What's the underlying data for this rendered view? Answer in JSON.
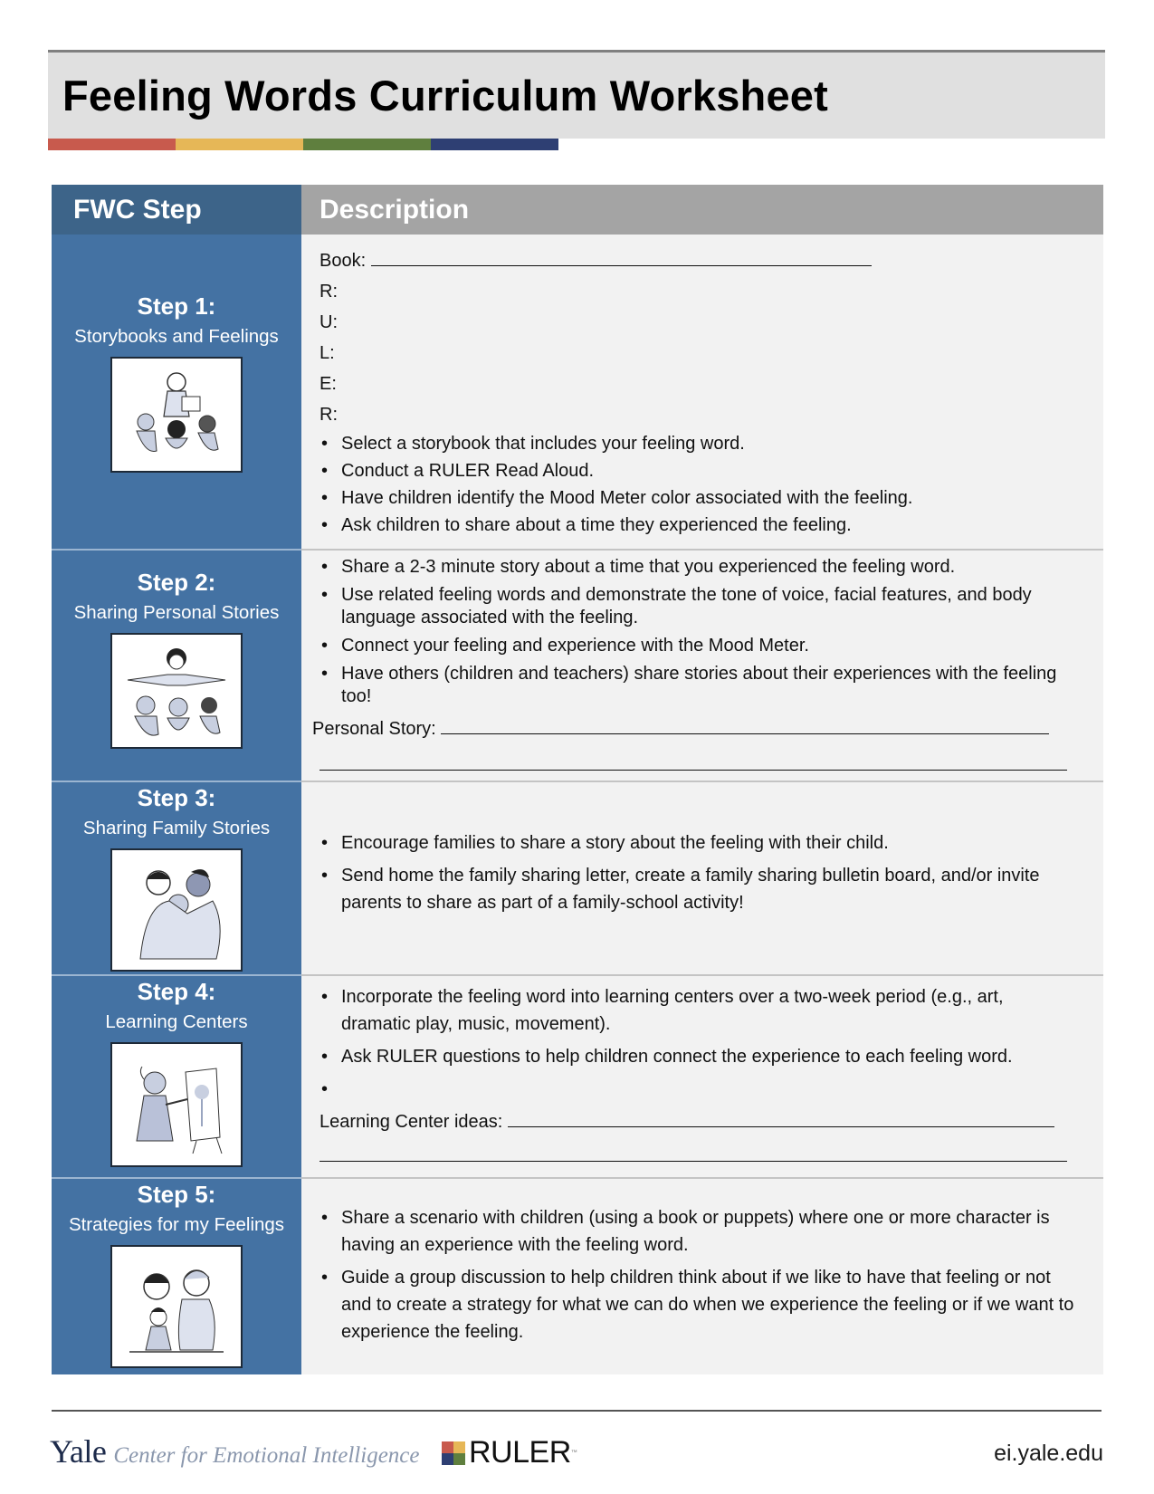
{
  "title": "Feeling Words Curriculum Worksheet",
  "color_bar": [
    "#c85a4d",
    "#e6b757",
    "#5f7f3e",
    "#2e3f73"
  ],
  "table": {
    "headers": {
      "step": "FWC Step",
      "description": "Description"
    },
    "rows": [
      {
        "step": "Step 1:",
        "title": "Storybooks and Feelings",
        "illustration": "teacher-reading-to-children",
        "fields_top": [
          {
            "label": "Book:",
            "blank": true
          },
          {
            "label": "R:"
          },
          {
            "label": "U:"
          },
          {
            "label": "L:"
          },
          {
            "label": "E:"
          },
          {
            "label": "R:"
          }
        ],
        "bullets": [
          "Select a storybook that includes your feeling word.",
          "Conduct a RULER Read Aloud.",
          "Have children identify the Mood Meter color associated with the feeling.",
          "Ask children to share about a time they experienced the feeling."
        ]
      },
      {
        "step": "Step 2:",
        "title": "Sharing Personal Stories",
        "illustration": "teacher-sharing-with-children",
        "bullets": [
          "Share a 2-3 minute story about a time that you experienced the feeling word.",
          "Use related feeling words and demonstrate the tone of voice, facial features, and body language associated with the feeling.",
          "Connect your feeling and experience with the Mood Meter.",
          "Have others (children and teachers) share stories about their experiences with the feeling too!"
        ],
        "field_bottom": "Personal Story:"
      },
      {
        "step": "Step 3:",
        "title": "Sharing Family Stories",
        "illustration": "family-hug",
        "bullets": [
          "Encourage families to share a story about the feeling with their child.",
          "Send home the family sharing letter, create a family sharing bulletin board, and/or invite parents to share as part of a family-school activity!"
        ]
      },
      {
        "step": "Step 4:",
        "title": "Learning Centers",
        "illustration": "girl-painting-at-easel",
        "bullets": [
          "Incorporate the feeling word into learning centers over a two-week period (e.g., art, dramatic play, music, movement).",
          "Ask RULER questions to help children connect the experience to each feeling word.",
          ""
        ],
        "field_bottom": "Learning Center ideas:"
      },
      {
        "step": "Step 5:",
        "title": "Strategies for my Feelings",
        "illustration": "adults-with-child",
        "bullets": [
          "Share a scenario with children (using a book or puppets) where one or more character is having an experience with the feeling word.",
          "Guide a group discussion to help children think about if we like to have that feeling or not and to create a strategy for what we can do when we experience the feeling or if we want to experience the feeling."
        ]
      }
    ]
  },
  "footer": {
    "yale": "Yale",
    "center": "Center for Emotional Intelligence",
    "ruler": "RULER",
    "ruler_tm": "™",
    "ruler_colors": [
      "#c85a4d",
      "#e6b757",
      "#2e3f73",
      "#5f7f3e"
    ],
    "url": "ei.yale.edu"
  }
}
